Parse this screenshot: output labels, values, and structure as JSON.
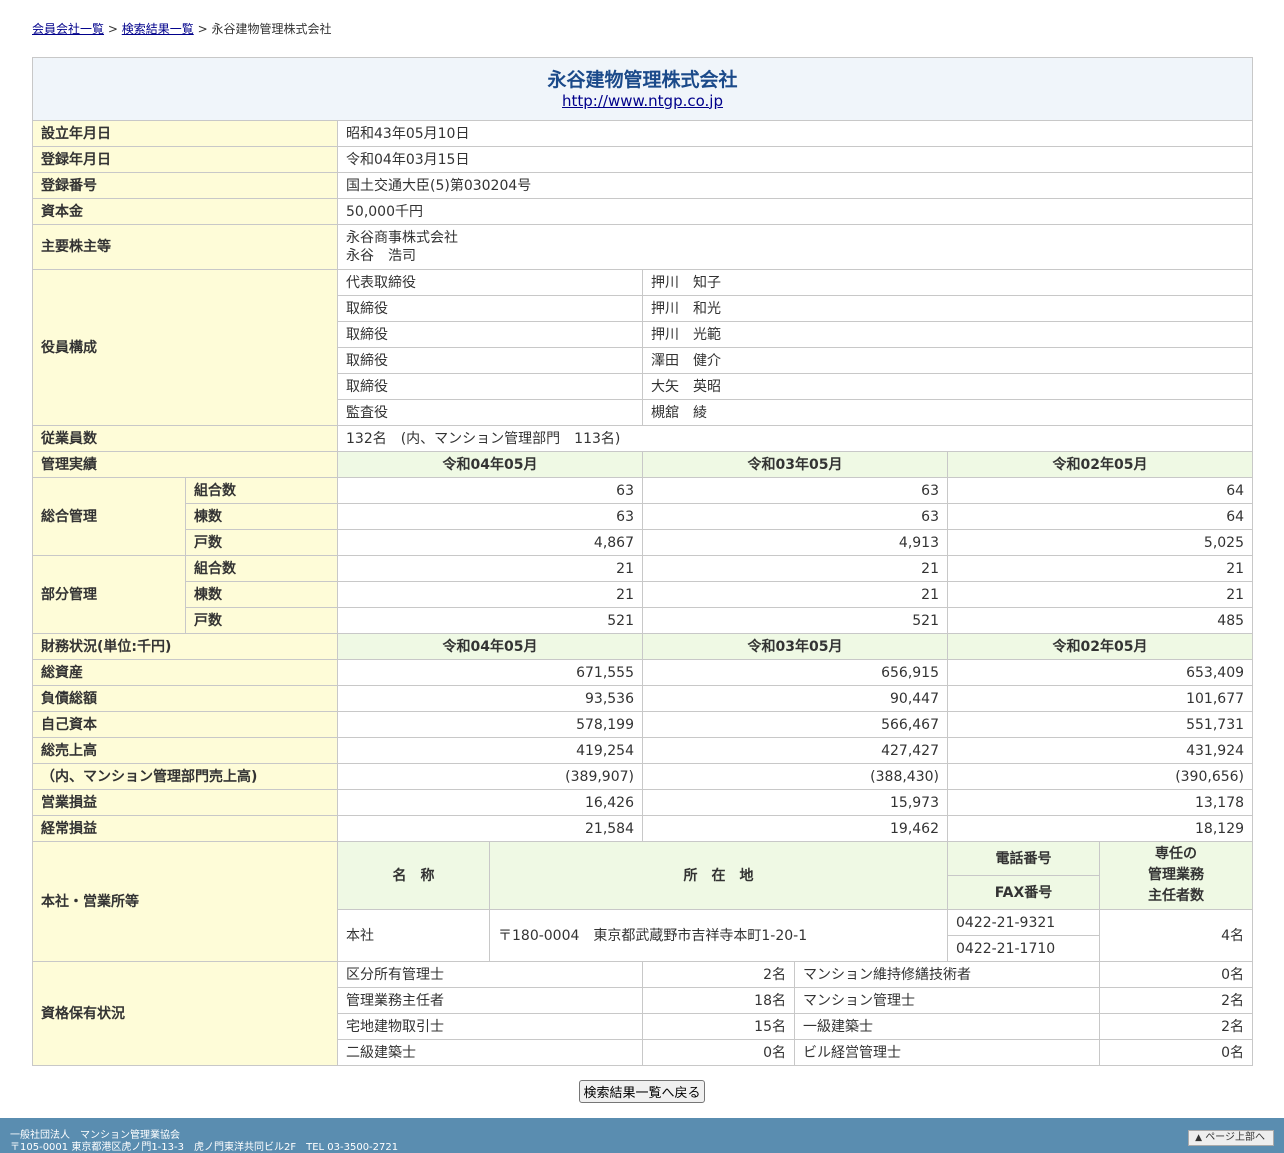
{
  "breadcrumb": {
    "member_list": "会員会社一覧",
    "sep": ">",
    "search_results": "検索結果一覧",
    "current": "永谷建物管理株式会社"
  },
  "company": {
    "name": "永谷建物管理株式会社",
    "url": "http://www.ntgp.co.jp"
  },
  "labels": {
    "established": "設立年月日",
    "registered": "登録年月日",
    "reg_no": "登録番号",
    "capital": "資本金",
    "shareholders": "主要株主等",
    "officers": "役員構成",
    "employees": "従業員数",
    "performance": "管理実績",
    "general_mgmt": "総合管理",
    "partial_mgmt": "部分管理",
    "associations": "組合数",
    "buildings": "棟数",
    "units": "戸数",
    "finance": "財務状況(単位:千円)",
    "total_assets": "総資産",
    "total_liabilities": "負債総額",
    "equity": "自己資本",
    "total_sales": "総売上高",
    "mansion_sales": "（内、マンション管理部門売上高)",
    "operating_income": "営業損益",
    "ordinary_income": "経常損益",
    "offices": "本社・営業所等",
    "office_name": "名　称",
    "office_address": "所　在　地",
    "phone": "電話番号",
    "fax": "FAX番号",
    "managers": "専任の\n管理業務\n主任者数",
    "qualifications": "資格保有状況"
  },
  "info": {
    "established": "昭和43年05月10日",
    "registered": "令和04年03月15日",
    "reg_no": "国土交通大臣(5)第030204号",
    "capital": "50,000千円",
    "shareholder_1": "永谷商事株式会社",
    "shareholder_2": "永谷　浩司",
    "employees": "132名　(内、マンション管理部門　113名)"
  },
  "officers": [
    {
      "role": "代表取締役",
      "name": "押川　知子"
    },
    {
      "role": "取締役",
      "name": "押川　和光"
    },
    {
      "role": "取締役",
      "name": "押川　光範"
    },
    {
      "role": "取締役",
      "name": "澤田　健介"
    },
    {
      "role": "取締役",
      "name": "大矢　英昭"
    },
    {
      "role": "監査役",
      "name": "槻舘　綾"
    }
  ],
  "periods": [
    "令和04年05月",
    "令和03年05月",
    "令和02年05月"
  ],
  "performance": {
    "general": {
      "associations": [
        "63",
        "63",
        "64"
      ],
      "buildings": [
        "63",
        "63",
        "64"
      ],
      "units": [
        "4,867",
        "4,913",
        "5,025"
      ]
    },
    "partial": {
      "associations": [
        "21",
        "21",
        "21"
      ],
      "buildings": [
        "21",
        "21",
        "21"
      ],
      "units": [
        "521",
        "521",
        "485"
      ]
    }
  },
  "finance": {
    "total_assets": [
      "671,555",
      "656,915",
      "653,409"
    ],
    "total_liabilities": [
      "93,536",
      "90,447",
      "101,677"
    ],
    "equity": [
      "578,199",
      "566,467",
      "551,731"
    ],
    "total_sales": [
      "419,254",
      "427,427",
      "431,924"
    ],
    "mansion_sales": [
      "(389,907)",
      "(388,430)",
      "(390,656)"
    ],
    "operating_income": [
      "16,426",
      "15,973",
      "13,178"
    ],
    "ordinary_income": [
      "21,584",
      "19,462",
      "18,129"
    ]
  },
  "office": {
    "name": "本社",
    "address": "〒180-0004　東京都武蔵野市吉祥寺本町1-20-1",
    "phone": "0422-21-9321",
    "fax": "0422-21-1710",
    "managers": "4名"
  },
  "qualifications": [
    {
      "left_name": "区分所有管理士",
      "left_count": "2名",
      "right_name": "マンション維持修繕技術者",
      "right_count": "0名"
    },
    {
      "left_name": "管理業務主任者",
      "left_count": "18名",
      "right_name": "マンション管理士",
      "right_count": "2名"
    },
    {
      "left_name": "宅地建物取引士",
      "left_count": "15名",
      "right_name": "一級建築士",
      "right_count": "2名"
    },
    {
      "left_name": "二級建築士",
      "left_count": "0名",
      "right_name": "ビル経営管理士",
      "right_count": "0名"
    }
  ],
  "back_button": "検索結果一覧へ戻る",
  "footer": {
    "org": "一般社団法人　マンション管理業協会",
    "address": "〒105-0001 東京都港区虎ノ門1-13-3　虎ノ門東洋共同ビル2F　TEL 03-3500-2721",
    "to_top": "ページ上部へ",
    "to_top_arrow": "▲"
  }
}
